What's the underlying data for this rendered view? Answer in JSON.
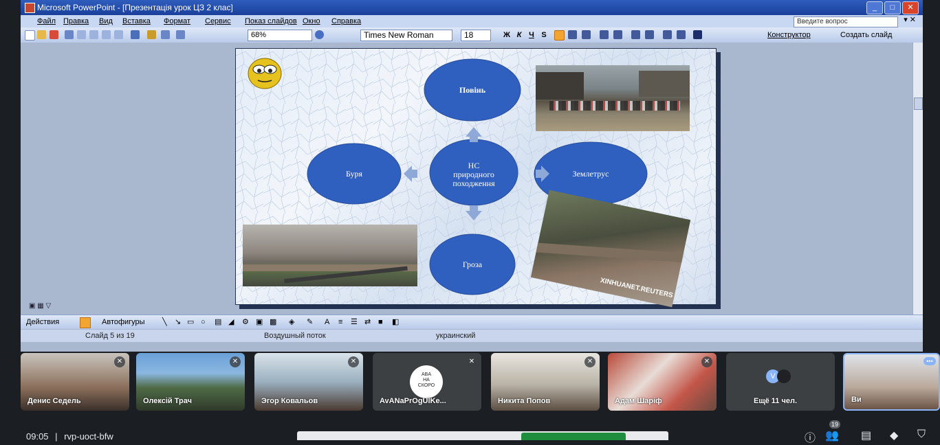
{
  "app": {
    "title": "Microsoft PowerPoint - [Презентація урок ЦЗ 2 клас]",
    "menu": [
      "Файл",
      "Правка",
      "Вид",
      "Вставка",
      "Формат",
      "Сервис",
      "Показ слайдов",
      "Окно",
      "Справка"
    ],
    "help_placeholder": "Введите вопрос",
    "toolbar": {
      "zoom": "68%",
      "font": "Times New Roman",
      "font_size": "18",
      "bold": "Ж",
      "italic": "К",
      "underline": "Ч",
      "shadow": "S",
      "design_label": "Конструктор",
      "new_slide_label": "Создать слайд"
    },
    "drawbar": {
      "actions_label": "Действия",
      "autoshapes_label": "Автофигуры"
    },
    "status": {
      "slide": "Слайд 5 из 19",
      "theme": "Воздушный поток",
      "language": "украинский"
    }
  },
  "slide": {
    "center": [
      "НС",
      "природного",
      "походження"
    ],
    "top": "Повінь",
    "right": "Землетрус",
    "bottom": "Гроза",
    "left": "Буря",
    "watermark": "XINHUANET.REUTERS",
    "colors": {
      "ellipse": "#2f5fbf",
      "arrow": "#8ea9d8"
    }
  },
  "meeting": {
    "participants": [
      {
        "name": "Денис Седель"
      },
      {
        "name": "Олексій Трач"
      },
      {
        "name": "Эгор Ковальов"
      },
      {
        "name": "AvANaPrOgUlKe...",
        "avatar_text": [
          "ABA",
          "НА",
          "СКОРО"
        ]
      },
      {
        "name": "Никита Попов"
      },
      {
        "name": "Адам Шаріф"
      },
      {
        "name": "Ещё 11 чел.",
        "avatar_letter": "V"
      },
      {
        "name": "Ви"
      }
    ],
    "time": "09:05",
    "separator": "|",
    "meeting_code": "rvp-uoct-bfw",
    "people_count": "19"
  }
}
